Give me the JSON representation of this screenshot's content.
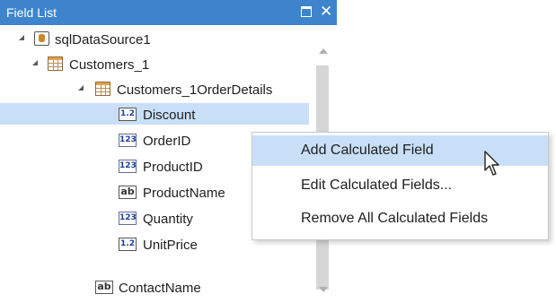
{
  "window": {
    "title": "Field List"
  },
  "tree": {
    "root": {
      "label": "sqlDataSource1",
      "icon": "database-icon"
    },
    "table": {
      "label": "Customers_1",
      "icon": "table-icon"
    },
    "relation": {
      "label": "Customers_1OrderDetails",
      "icon": "table-icon"
    },
    "fields": [
      {
        "label": "Discount",
        "icon_text": "1.2",
        "icon": "decimal-field-icon"
      },
      {
        "label": "OrderID",
        "icon_text": "123",
        "icon": "integer-field-icon"
      },
      {
        "label": "ProductID",
        "icon_text": "123",
        "icon": "integer-field-icon"
      },
      {
        "label": "ProductName",
        "icon_text": "ab",
        "icon": "string-field-icon"
      },
      {
        "label": "Quantity",
        "icon_text": "123",
        "icon": "integer-field-icon"
      },
      {
        "label": "UnitPrice",
        "icon_text": "1.2",
        "icon": "decimal-field-icon"
      }
    ],
    "extra_field": {
      "label": "ContactName",
      "icon_text": "ab",
      "icon": "string-field-icon"
    }
  },
  "context_menu": {
    "items": [
      {
        "label": "Add Calculated Field"
      },
      {
        "label": "Edit Calculated Fields..."
      },
      {
        "label": "Remove All Calculated Fields"
      }
    ]
  },
  "colors": {
    "titlebar": "#3e84cc",
    "selection": "#c9dff7"
  }
}
